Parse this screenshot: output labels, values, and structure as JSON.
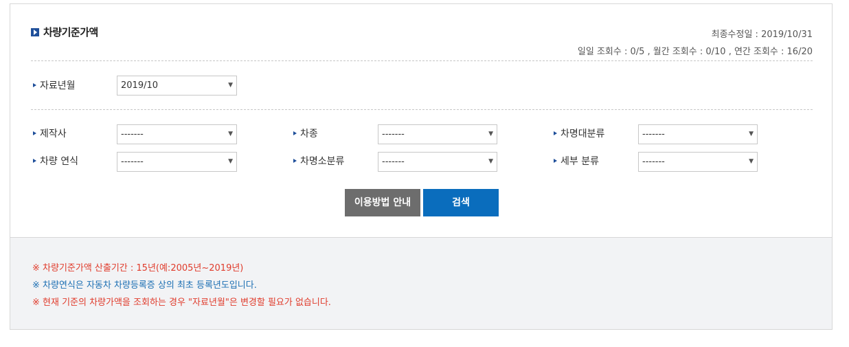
{
  "header": {
    "title": "차량기준가액",
    "last_modified": "최종수정일 : 2019/10/31",
    "view_counts": "일일 조회수 : 0/5 , 월간 조회수 : 0/10 , 연간 조회수 : 16/20"
  },
  "data_month": {
    "label": "자료년월",
    "value": "2019/10"
  },
  "filters": [
    {
      "label": "제작사",
      "value": "-------"
    },
    {
      "label": "차종",
      "value": "-------"
    },
    {
      "label": "차명대분류",
      "value": "-------"
    },
    {
      "label": "차량 연식",
      "value": "-------"
    },
    {
      "label": "차명소분류",
      "value": "-------"
    },
    {
      "label": "세부 분류",
      "value": "-------"
    }
  ],
  "buttons": {
    "guide": "이용방법 안내",
    "search": "검색"
  },
  "notes": [
    {
      "text": "※ 차량기준가액 산출기간 : 15년(예:2005년~2019년)",
      "color": "#e03b2b"
    },
    {
      "text": "※ 차량연식은 자동차 차량등록증 상의 최초 등록년도입니다.",
      "color": "#1c6fb3"
    },
    {
      "text": "※ 현재 기준의 차량가액을 조회하는 경우 \"자료년월\"은 변경할 필요가 없습니다.",
      "color": "#e03b2b"
    }
  ],
  "colors": {
    "accent": "#1f4f9a",
    "search_button": "#0a6dbd",
    "guide_button": "#6d6d6d",
    "notes_bg": "#f2f3f5"
  },
  "icons": {
    "title": "play-square-icon",
    "select": "chevron-down-icon",
    "label": "triangle-bullet-icon"
  }
}
